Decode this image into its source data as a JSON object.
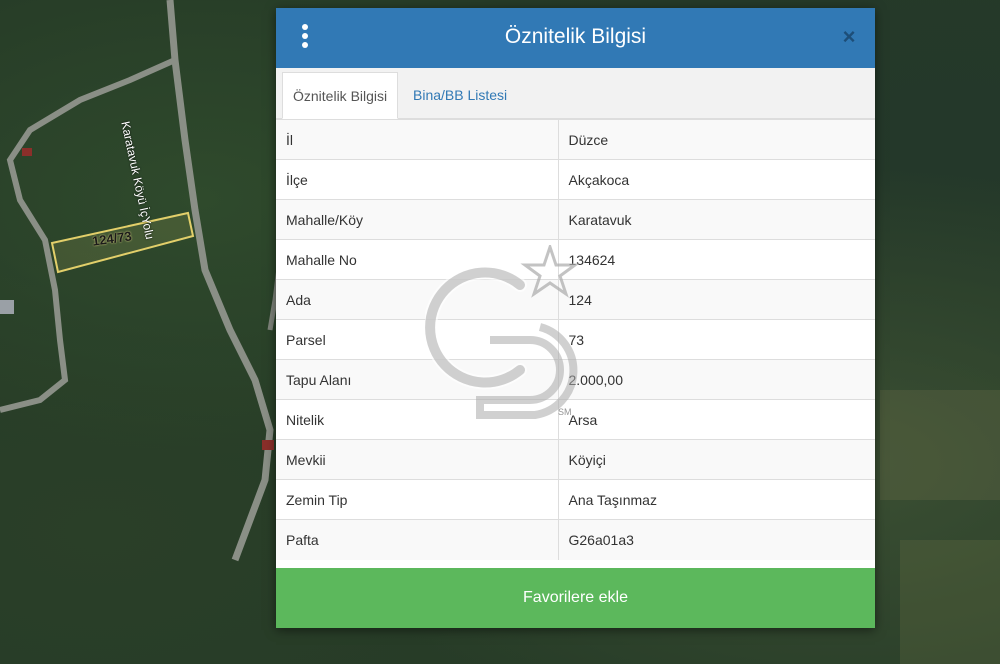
{
  "map": {
    "parcel_label": "124/73",
    "road_label": "Karatavuk Köyü İçYolu"
  },
  "modal": {
    "title": "Öznitelik Bilgisi",
    "menu_icon": "vertical-ellipsis-icon",
    "close_icon": "close-icon",
    "close_glyph": "×",
    "tabs": [
      {
        "label": "Öznitelik Bilgisi",
        "active": true
      },
      {
        "label": "Bina/BB Listesi",
        "active": false
      }
    ],
    "rows": [
      {
        "key": "İl",
        "value": "Düzce"
      },
      {
        "key": "İlçe",
        "value": "Akçakoca"
      },
      {
        "key": "Mahalle/Köy",
        "value": "Karatavuk"
      },
      {
        "key": "Mahalle No",
        "value": "134624"
      },
      {
        "key": "Ada",
        "value": "124"
      },
      {
        "key": "Parsel",
        "value": "73"
      },
      {
        "key": "Tapu Alanı",
        "value": "2.000,00"
      },
      {
        "key": "Nitelik",
        "value": "Arsa"
      },
      {
        "key": "Mevkii",
        "value": "Köyiçi"
      },
      {
        "key": "Zemin Tip",
        "value": "Ana Taşınmaz"
      },
      {
        "key": "Pafta",
        "value": "G26a01a3"
      }
    ],
    "favorite_button": "Favorilere ekle"
  },
  "watermark": {
    "mark": "SM"
  },
  "colors": {
    "header": "#3179b5",
    "favorite_button": "#5cb85c",
    "tab_link": "#3179b5"
  }
}
